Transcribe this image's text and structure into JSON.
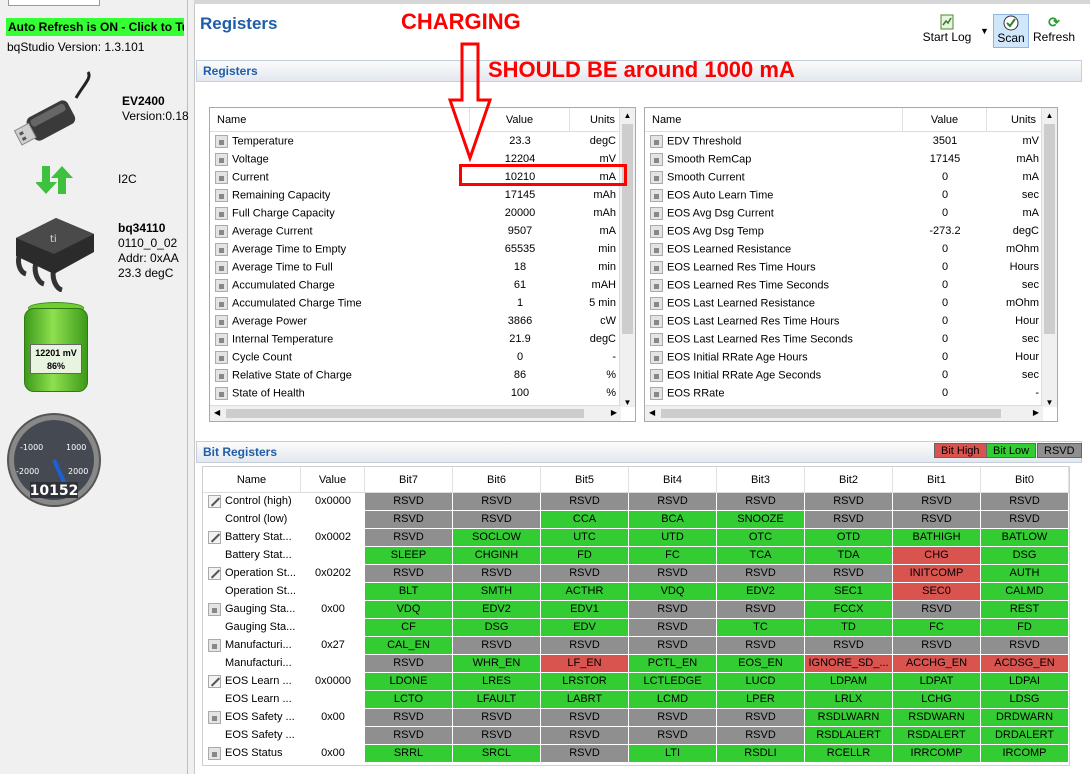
{
  "left_panel": {
    "auto_refresh": "Auto Refresh is ON - Click to Tu",
    "version": "bqStudio Version:  1.3.101",
    "adapter_name": "EV2400",
    "adapter_version": "Version:0.18",
    "bus": "I2C",
    "device_name": "bq34110",
    "device_fw": "0110_0_02",
    "device_addr": "Addr: 0xAA",
    "device_temp": "23.3 degC",
    "battery_mv": "12201 mV",
    "battery_pct": "86%",
    "battery_fill": 0.86,
    "gauge_value": "10152",
    "gauge_ticks": [
      "-1000",
      "1000",
      "-2000",
      "2000"
    ]
  },
  "header": {
    "title": "Registers",
    "start_log": "Start Log",
    "scan": "Scan",
    "refresh": "Refresh"
  },
  "annotations": {
    "charging": "CHARGING",
    "should_be": "SHOULD BE around 1000 mA"
  },
  "registers": {
    "section_title": "Registers",
    "columns": {
      "name": "Name",
      "value": "Value",
      "units": "Units"
    },
    "left": [
      {
        "name": "Temperature",
        "value": "23.3",
        "units": "degC"
      },
      {
        "name": "Voltage",
        "value": "12204",
        "units": "mV"
      },
      {
        "name": "Current",
        "value": "10210",
        "units": "mA"
      },
      {
        "name": "Remaining Capacity",
        "value": "17145",
        "units": "mAh"
      },
      {
        "name": "Full Charge Capacity",
        "value": "20000",
        "units": "mAh"
      },
      {
        "name": "Average Current",
        "value": "9507",
        "units": "mA"
      },
      {
        "name": "Average Time to Empty",
        "value": "65535",
        "units": "min"
      },
      {
        "name": "Average Time to Full",
        "value": "18",
        "units": "min"
      },
      {
        "name": "Accumulated Charge",
        "value": "61",
        "units": "mAH"
      },
      {
        "name": "Accumulated Charge Time",
        "value": "1",
        "units": "5 min"
      },
      {
        "name": "Average Power",
        "value": "3866",
        "units": "cW"
      },
      {
        "name": "Internal Temperature",
        "value": "21.9",
        "units": "degC"
      },
      {
        "name": "Cycle Count",
        "value": "0",
        "units": "-"
      },
      {
        "name": "Relative State of Charge",
        "value": "86",
        "units": "%"
      },
      {
        "name": "State of Health",
        "value": "100",
        "units": "%"
      }
    ],
    "right": [
      {
        "name": "EDV Threshold",
        "value": "3501",
        "units": "mV"
      },
      {
        "name": "Smooth RemCap",
        "value": "17145",
        "units": "mAh"
      },
      {
        "name": "Smooth Current",
        "value": "0",
        "units": "mA"
      },
      {
        "name": "EOS Auto Learn Time",
        "value": "0",
        "units": "sec"
      },
      {
        "name": "EOS Avg Dsg Current",
        "value": "0",
        "units": "mA"
      },
      {
        "name": "EOS Avg Dsg Temp",
        "value": "-273.2",
        "units": "degC"
      },
      {
        "name": "EOS Learned Resistance",
        "value": "0",
        "units": "mOhm"
      },
      {
        "name": "EOS Learned Res Time Hours",
        "value": "0",
        "units": "Hours"
      },
      {
        "name": "EOS Learned Res Time Seconds",
        "value": "0",
        "units": "sec"
      },
      {
        "name": "EOS Last Learned Resistance",
        "value": "0",
        "units": "mOhm"
      },
      {
        "name": "EOS Last Learned Res Time Hours",
        "value": "0",
        "units": "Hour"
      },
      {
        "name": "EOS Last Learned Res Time Seconds",
        "value": "0",
        "units": "sec"
      },
      {
        "name": "EOS Initial RRate Age Hours",
        "value": "0",
        "units": "Hour"
      },
      {
        "name": "EOS Initial RRate Age Seconds",
        "value": "0",
        "units": "sec"
      },
      {
        "name": "EOS RRate",
        "value": "0",
        "units": "-"
      }
    ]
  },
  "bit_registers": {
    "section_title": "Bit Registers",
    "legend": {
      "high": "Bit High",
      "low": "Bit Low",
      "rsvd": "RSVD"
    },
    "colors": {
      "high": "#d9534f",
      "low": "#33cc33",
      "rsvd": "#8f8f8f"
    },
    "columns": [
      "Name",
      "Value",
      "Bit7",
      "Bit6",
      "Bit5",
      "Bit4",
      "Bit3",
      "Bit2",
      "Bit1",
      "Bit0"
    ],
    "rows": [
      {
        "icon": "pencil",
        "name": "Control (high)",
        "value": "0x0000",
        "bits": [
          [
            "RSVD",
            "r"
          ],
          [
            "RSVD",
            "r"
          ],
          [
            "RSVD",
            "r"
          ],
          [
            "RSVD",
            "r"
          ],
          [
            "RSVD",
            "r"
          ],
          [
            "RSVD",
            "r"
          ],
          [
            "RSVD",
            "r"
          ],
          [
            "RSVD",
            "r"
          ]
        ]
      },
      {
        "icon": "",
        "name": "Control (low)",
        "value": "",
        "bits": [
          [
            "RSVD",
            "r"
          ],
          [
            "RSVD",
            "r"
          ],
          [
            "CCA",
            "l"
          ],
          [
            "BCA",
            "l"
          ],
          [
            "SNOOZE",
            "l"
          ],
          [
            "RSVD",
            "r"
          ],
          [
            "RSVD",
            "r"
          ],
          [
            "RSVD",
            "r"
          ]
        ]
      },
      {
        "icon": "pencil",
        "name": "Battery Stat...",
        "value": "0x0002",
        "bits": [
          [
            "RSVD",
            "r"
          ],
          [
            "SOCLOW",
            "l"
          ],
          [
            "UTC",
            "l"
          ],
          [
            "UTD",
            "l"
          ],
          [
            "OTC",
            "l"
          ],
          [
            "OTD",
            "l"
          ],
          [
            "BATHIGH",
            "l"
          ],
          [
            "BATLOW",
            "l"
          ]
        ]
      },
      {
        "icon": "",
        "name": "Battery Stat...",
        "value": "",
        "bits": [
          [
            "SLEEP",
            "l"
          ],
          [
            "CHGINH",
            "l"
          ],
          [
            "FD",
            "l"
          ],
          [
            "FC",
            "l"
          ],
          [
            "TCA",
            "l"
          ],
          [
            "TDA",
            "l"
          ],
          [
            "CHG",
            "h"
          ],
          [
            "DSG",
            "l"
          ]
        ]
      },
      {
        "icon": "pencil",
        "name": "Operation St...",
        "value": "0x0202",
        "bits": [
          [
            "RSVD",
            "r"
          ],
          [
            "RSVD",
            "r"
          ],
          [
            "RSVD",
            "r"
          ],
          [
            "RSVD",
            "r"
          ],
          [
            "RSVD",
            "r"
          ],
          [
            "RSVD",
            "r"
          ],
          [
            "INITCOMP",
            "h"
          ],
          [
            "AUTH",
            "l"
          ]
        ]
      },
      {
        "icon": "",
        "name": "Operation St...",
        "value": "",
        "bits": [
          [
            "BLT",
            "l"
          ],
          [
            "SMTH",
            "l"
          ],
          [
            "ACTHR",
            "l"
          ],
          [
            "VDQ",
            "l"
          ],
          [
            "EDV2",
            "l"
          ],
          [
            "SEC1",
            "l"
          ],
          [
            "SEC0",
            "h"
          ],
          [
            "CALMD",
            "l"
          ]
        ]
      },
      {
        "icon": "lock",
        "name": "Gauging Sta...",
        "value": "0x00",
        "bits": [
          [
            "VDQ",
            "l"
          ],
          [
            "EDV2",
            "l"
          ],
          [
            "EDV1",
            "l"
          ],
          [
            "RSVD",
            "r"
          ],
          [
            "RSVD",
            "r"
          ],
          [
            "FCCX",
            "l"
          ],
          [
            "RSVD",
            "r"
          ],
          [
            "REST",
            "l"
          ]
        ]
      },
      {
        "icon": "",
        "name": "Gauging Sta...",
        "value": "",
        "bits": [
          [
            "CF",
            "l"
          ],
          [
            "DSG",
            "l"
          ],
          [
            "EDV",
            "l"
          ],
          [
            "RSVD",
            "r"
          ],
          [
            "TC",
            "l"
          ],
          [
            "TD",
            "l"
          ],
          [
            "FC",
            "l"
          ],
          [
            "FD",
            "l"
          ]
        ]
      },
      {
        "icon": "lock",
        "name": "Manufacturi...",
        "value": "0x27",
        "bits": [
          [
            "CAL_EN",
            "l"
          ],
          [
            "RSVD",
            "r"
          ],
          [
            "RSVD",
            "r"
          ],
          [
            "RSVD",
            "r"
          ],
          [
            "RSVD",
            "r"
          ],
          [
            "RSVD",
            "r"
          ],
          [
            "RSVD",
            "r"
          ],
          [
            "RSVD",
            "r"
          ]
        ]
      },
      {
        "icon": "",
        "name": "Manufacturi...",
        "value": "",
        "bits": [
          [
            "RSVD",
            "r"
          ],
          [
            "WHR_EN",
            "l"
          ],
          [
            "LF_EN",
            "h"
          ],
          [
            "PCTL_EN",
            "l"
          ],
          [
            "EOS_EN",
            "l"
          ],
          [
            "IGNORE_SD_...",
            "h"
          ],
          [
            "ACCHG_EN",
            "h"
          ],
          [
            "ACDSG_EN",
            "h"
          ]
        ]
      },
      {
        "icon": "pencil",
        "name": "EOS Learn ...",
        "value": "0x0000",
        "bits": [
          [
            "LDONE",
            "l"
          ],
          [
            "LRES",
            "l"
          ],
          [
            "LRSTOR",
            "l"
          ],
          [
            "LCTLEDGE",
            "l"
          ],
          [
            "LUCD",
            "l"
          ],
          [
            "LDPAM",
            "l"
          ],
          [
            "LDPAT",
            "l"
          ],
          [
            "LDPAI",
            "l"
          ]
        ]
      },
      {
        "icon": "",
        "name": "EOS Learn ...",
        "value": "",
        "bits": [
          [
            "LCTO",
            "l"
          ],
          [
            "LFAULT",
            "l"
          ],
          [
            "LABRT",
            "l"
          ],
          [
            "LCMD",
            "l"
          ],
          [
            "LPER",
            "l"
          ],
          [
            "LRLX",
            "l"
          ],
          [
            "LCHG",
            "l"
          ],
          [
            "LDSG",
            "l"
          ]
        ]
      },
      {
        "icon": "lock",
        "name": "EOS Safety ...",
        "value": "0x00",
        "bits": [
          [
            "RSVD",
            "r"
          ],
          [
            "RSVD",
            "r"
          ],
          [
            "RSVD",
            "r"
          ],
          [
            "RSVD",
            "r"
          ],
          [
            "RSVD",
            "r"
          ],
          [
            "RSDLWARN",
            "l"
          ],
          [
            "RSDWARN",
            "l"
          ],
          [
            "DRDWARN",
            "l"
          ]
        ]
      },
      {
        "icon": "",
        "name": "EOS Safety ...",
        "value": "",
        "bits": [
          [
            "RSVD",
            "r"
          ],
          [
            "RSVD",
            "r"
          ],
          [
            "RSVD",
            "r"
          ],
          [
            "RSVD",
            "r"
          ],
          [
            "RSVD",
            "r"
          ],
          [
            "RSDLALERT",
            "l"
          ],
          [
            "RSDALERT",
            "l"
          ],
          [
            "DRDALERT",
            "l"
          ]
        ]
      },
      {
        "icon": "lock",
        "name": "EOS Status",
        "value": "0x00",
        "bits": [
          [
            "SRRL",
            "l"
          ],
          [
            "SRCL",
            "l"
          ],
          [
            "RSVD",
            "r"
          ],
          [
            "LTI",
            "l"
          ],
          [
            "RSDLI",
            "l"
          ],
          [
            "RCELLR",
            "l"
          ],
          [
            "IRRCOMP",
            "l"
          ],
          [
            "IRCOMP",
            "l"
          ]
        ]
      }
    ]
  }
}
